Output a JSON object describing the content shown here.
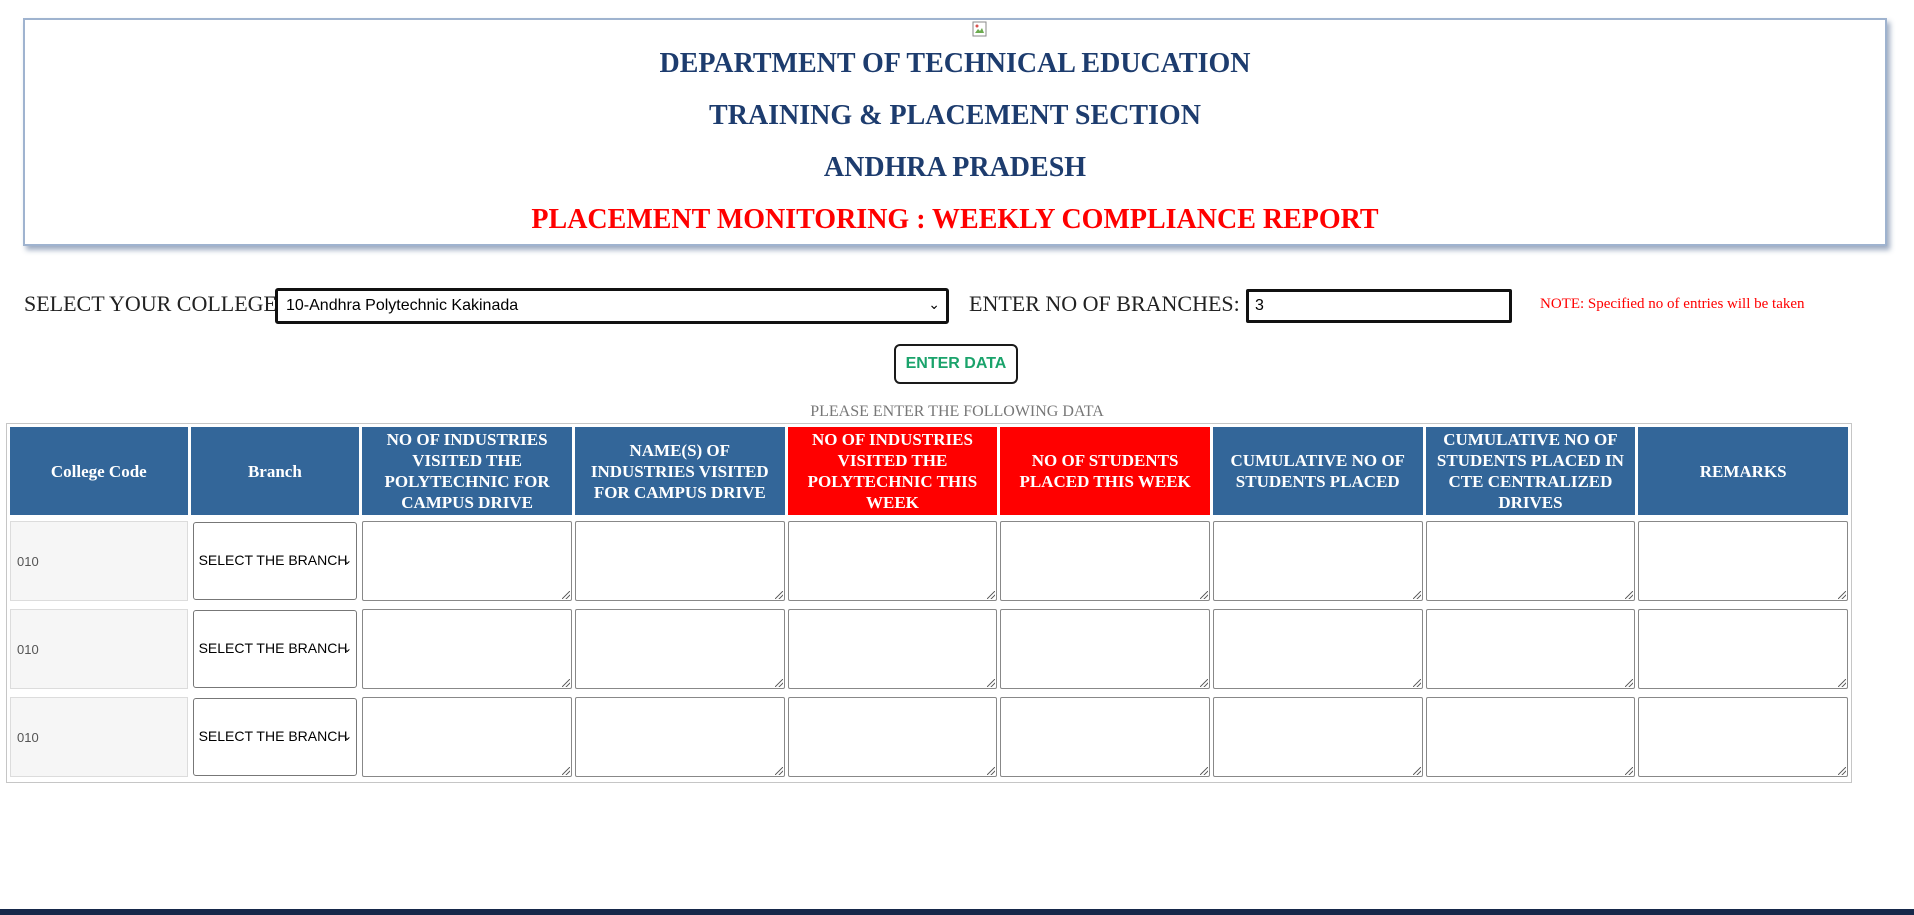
{
  "header": {
    "line1": "DEPARTMENT OF TECHNICAL EDUCATION",
    "line2": "TRAINING & PLACEMENT SECTION",
    "line3": "ANDHRA PRADESH",
    "line4": "PLACEMENT MONITORING : WEEKLY COMPLIANCE REPORT"
  },
  "form": {
    "college_label": "SELECT YOUR COLLEGE:",
    "college_value": "10-Andhra Polytechnic Kakinada",
    "branches_label": "ENTER NO OF BRANCHES:",
    "branches_value": "3",
    "note": "NOTE: Specified no of entries will be taken",
    "enter_button": "ENTER DATA",
    "instruction": "PLEASE ENTER THE FOLLOWING DATA"
  },
  "table": {
    "headers": [
      "College Code",
      "Branch",
      "NO OF INDUSTRIES VISITED THE POLYTECHNIC FOR CAMPUS DRIVE",
      "NAME(S) OF INDUSTRIES VISITED FOR CAMPUS DRIVE",
      "NO OF INDUSTRIES VISITED THE POLYTECHNIC THIS WEEK",
      "NO OF STUDENTS PLACED THIS WEEK",
      "CUMULATIVE NO OF STUDENTS PLACED",
      "CUMULATIVE NO OF STUDENTS PLACED IN CTE CENTRALIZED DRIVES",
      "REMARKS"
    ],
    "rows": [
      {
        "code": "010",
        "branch": "SELECT THE BRANCH"
      },
      {
        "code": "010",
        "branch": "SELECT THE BRANCH"
      },
      {
        "code": "010",
        "branch": "SELECT THE BRANCH"
      }
    ]
  },
  "colors": {
    "header_blue": "#336699",
    "header_red": "#ff0000",
    "title_navy": "#1d3c6e",
    "note_red": "#ff0000",
    "button_green": "#1aa36b"
  },
  "icons": [
    "broken-image-icon",
    "chevron-down-icon",
    "resize-grip-icon"
  ]
}
